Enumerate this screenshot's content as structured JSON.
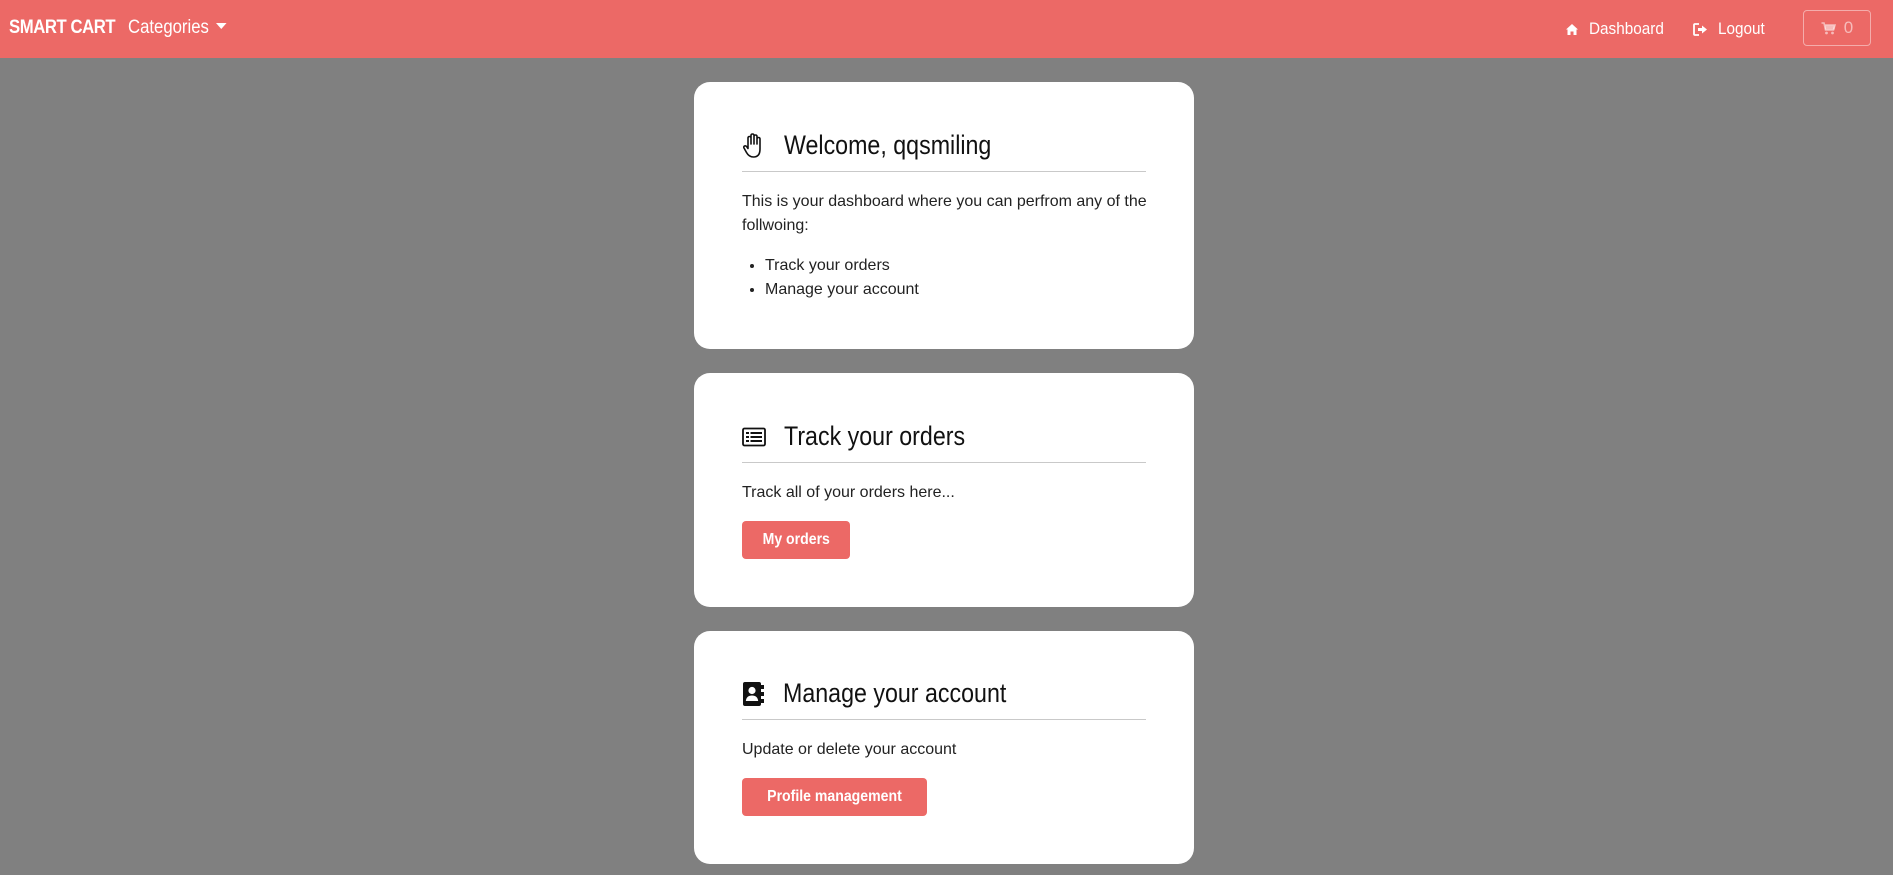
{
  "navbar": {
    "brand": "SMART CART",
    "categories_label": "Categories",
    "dashboard_label": "Dashboard",
    "logout_label": "Logout",
    "cart_count": "0",
    "icons": {
      "dashboard": "home-icon",
      "logout": "sign-out-icon",
      "cart": "shopping-cart-icon"
    },
    "color": "#ec6966"
  },
  "welcome_card": {
    "icon": "hand-paper-icon",
    "title": "Welcome, qqsmiling",
    "text": "This is your dashboard where you can perfrom any of the follwoing:",
    "items": [
      "Track your orders",
      "Manage your account"
    ]
  },
  "orders_card": {
    "icon": "list-alt-icon",
    "title": "Track your orders",
    "text": "Track all of your orders here...",
    "button_label": "My orders"
  },
  "account_card": {
    "icon": "address-book-icon",
    "title": "Manage your account",
    "text": "Update or delete your account",
    "button_label": "Profile management"
  }
}
